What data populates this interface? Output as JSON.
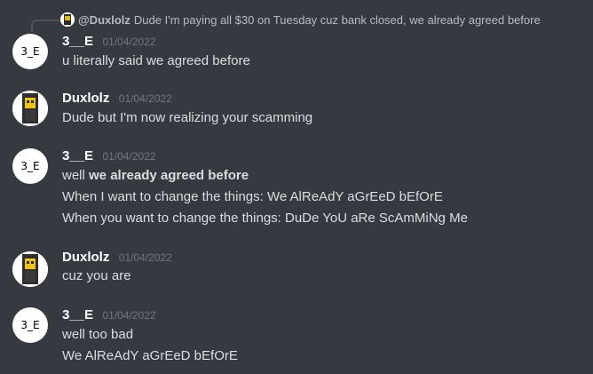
{
  "reply": {
    "mention": "@Duxlolz",
    "text": "Dude I'm paying all $30 on Tuesday cuz bank closed, we already agreed before"
  },
  "messages": [
    {
      "author": "3__E",
      "avatar_text": "3_E",
      "timestamp": "01/04/2022",
      "lines": [
        "u literally said we agreed before"
      ]
    },
    {
      "author": "Duxlolz",
      "timestamp": "01/04/2022",
      "lines": [
        "Dude but I'm now realizing your scamming"
      ]
    },
    {
      "author": "3__E",
      "avatar_text": "3_E",
      "timestamp": "01/04/2022",
      "line1_prefix": "well ",
      "line1_bold": "we already agreed before",
      "lines": [
        "When I want to change the things: We AlReAdY aGrEeD bEfOrE",
        "When you want to change the things: DuDe YoU aRe ScAmMiNg Me"
      ]
    },
    {
      "author": "Duxlolz",
      "timestamp": "01/04/2022",
      "lines": [
        "cuz you are"
      ]
    },
    {
      "author": "3__E",
      "avatar_text": "3_E",
      "timestamp": "01/04/2022",
      "lines": [
        "well too bad",
        "We AlReAdY aGrEeD bEfOrE"
      ]
    }
  ],
  "colors": {
    "background": "#36393f",
    "username": "#ffffff",
    "text": "#dcddde",
    "timestamp": "#72767d",
    "reply_text": "#b9bbbe"
  }
}
